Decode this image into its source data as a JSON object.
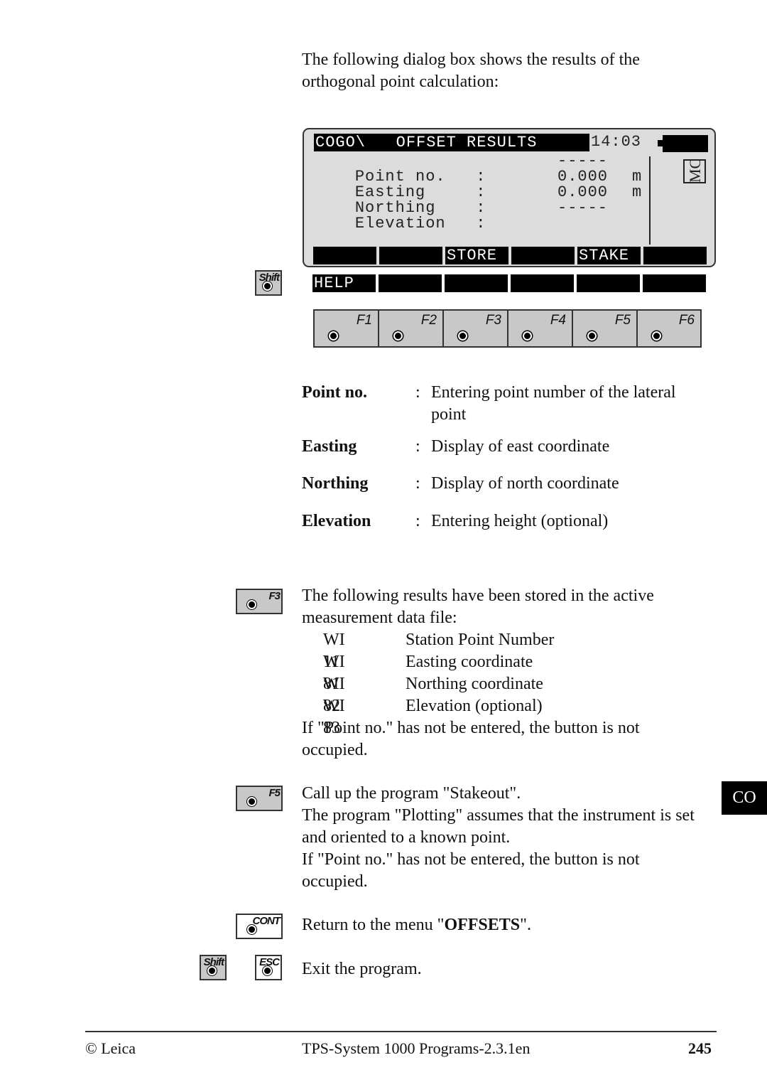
{
  "intro": "The following dialog box shows the results of the orthogonal point calculation:",
  "screen": {
    "title": "COGO\\   OFFSET RESULTS",
    "time": "14:03",
    "badge": "MC",
    "rows": [
      {
        "label": "Point no.   :",
        "value": "-----",
        "unit": ""
      },
      {
        "label": "Easting     :",
        "value": "0.000",
        "unit": "m"
      },
      {
        "label": "Northing    :",
        "value": "0.000",
        "unit": "m"
      },
      {
        "label": "Elevation   :",
        "value": "-----",
        "unit": ""
      }
    ],
    "softkeys": [
      "",
      "",
      "STORE",
      "",
      "STAKE",
      ""
    ],
    "shift_softkeys": [
      "HELP",
      "",
      "",
      "",
      "",
      ""
    ]
  },
  "keys": {
    "shift": "Shift",
    "function_keys": [
      "F1",
      "F2",
      "F3",
      "F4",
      "F5",
      "F6"
    ],
    "f3": "F3",
    "f5": "F5",
    "cont": "CONT",
    "esc": "ESC"
  },
  "definitions": [
    {
      "term": "Point no.",
      "desc": "Entering point number of the lateral point"
    },
    {
      "term": "Easting",
      "desc": "Display of east coordinate"
    },
    {
      "term": "Northing",
      "desc": "Display of north coordinate"
    },
    {
      "term": "Elevation",
      "desc": "Entering height (optional)"
    }
  ],
  "store_section": {
    "text": "The following results have been stored in the active measurement data file:",
    "items": [
      {
        "code": "WI 11",
        "desc": "Station Point Number"
      },
      {
        "code": "WI 81",
        "desc": "Easting coordinate"
      },
      {
        "code": "WI 82",
        "desc": "Northing coordinate"
      },
      {
        "code": "WI 83",
        "desc": "Elevation (optional)"
      }
    ],
    "note": "If \"Point no.\" has not be entered, the button is not occupied."
  },
  "stake_section": {
    "line1": "Call up the program \"Stakeout\".",
    "line2": "The program \"Plotting\" assumes that the instrument is set and oriented to a known point.",
    "note": "If \"Point no.\" has not be entered, the button is not occupied."
  },
  "cont_section": {
    "pre": "Return to the menu \"",
    "bold": "OFFSETS",
    "post": "\"."
  },
  "esc_section": {
    "text": "Exit the program."
  },
  "side_tab": "CO",
  "footer": {
    "left": "© Leica",
    "center": "TPS-System 1000 Programs-2.3.1en",
    "page": "245"
  }
}
